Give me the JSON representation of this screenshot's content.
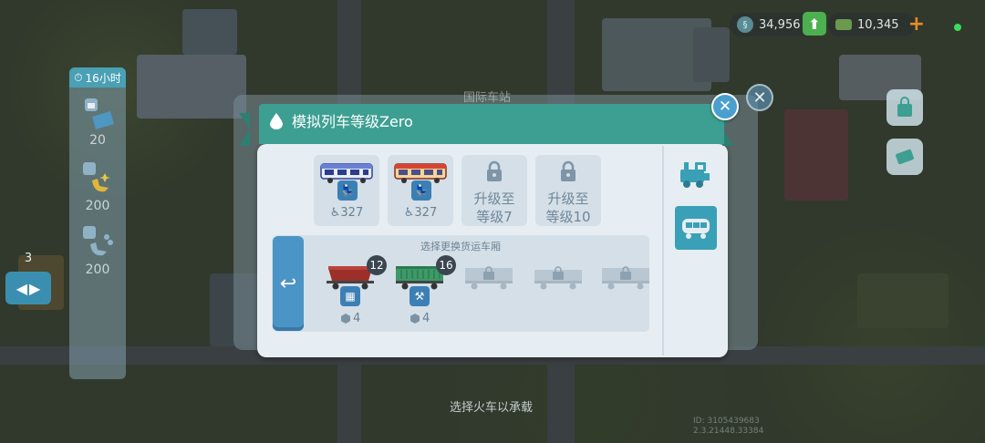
{
  "hud": {
    "money": "34,956",
    "simcash": "10,345"
  },
  "left_panel": {
    "timer": "16小时",
    "items": [
      {
        "value": "20",
        "icon": "factory-icon"
      },
      {
        "value": "200",
        "icon": "seat-icon"
      },
      {
        "value": "200",
        "icon": "seat-icon"
      }
    ],
    "count": "3"
  },
  "background": {
    "dialog_title": "国际车站",
    "hint": "选择火车以承载",
    "build_info": [
      "ID: 3105439683",
      "2.3.21448.33384"
    ]
  },
  "dialog": {
    "title": "模拟列车等级Zero",
    "trains": [
      {
        "capacity": "327",
        "color": "#6a7fd6"
      },
      {
        "capacity": "327",
        "color": "#d8442f"
      }
    ],
    "locked": [
      {
        "line1": "升级至",
        "line2": "等级7"
      },
      {
        "line1": "升级至",
        "line2": "等级10"
      }
    ],
    "cargo_label": "选择更换货运车厢",
    "wagons": [
      {
        "count": "12",
        "cost": "4",
        "color": "#9c2f2a",
        "badge_icon": "factory-icon"
      },
      {
        "count": "16",
        "cost": "4",
        "color": "#3c9a68",
        "badge_icon": "hammer-icon"
      }
    ]
  },
  "colors": {
    "accent": "#3d9f92",
    "button_blue": "#4b94c6",
    "dialog_bg": "#e7eef3"
  }
}
